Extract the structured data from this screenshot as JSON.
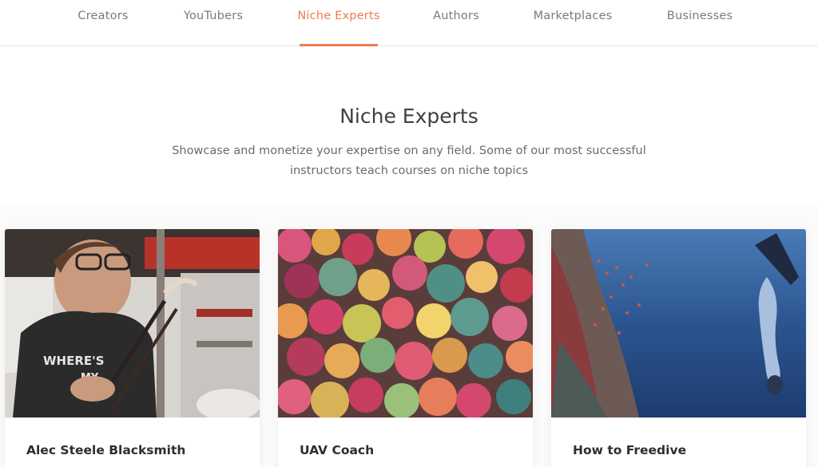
{
  "nav": {
    "tabs": [
      {
        "label": "Creators"
      },
      {
        "label": "YouTubers"
      },
      {
        "label": "Niche Experts"
      },
      {
        "label": "Authors"
      },
      {
        "label": "Marketplaces"
      },
      {
        "label": "Businesses"
      }
    ],
    "active_color": "#f07b4d"
  },
  "section": {
    "title": "Niche Experts",
    "subtitle_line1": "Showcase and monetize your expertise on any field. Some of our most successful",
    "subtitle_line2": "instructors teach courses on niche topics"
  },
  "cards": [
    {
      "title": "Alec Steele Blacksmith",
      "image": "blacksmith-photo"
    },
    {
      "title": "UAV Coach",
      "image": "aerial-autumn-forest-photo"
    },
    {
      "title": "How to Freedive",
      "image": "freediver-underwater-photo"
    }
  ]
}
